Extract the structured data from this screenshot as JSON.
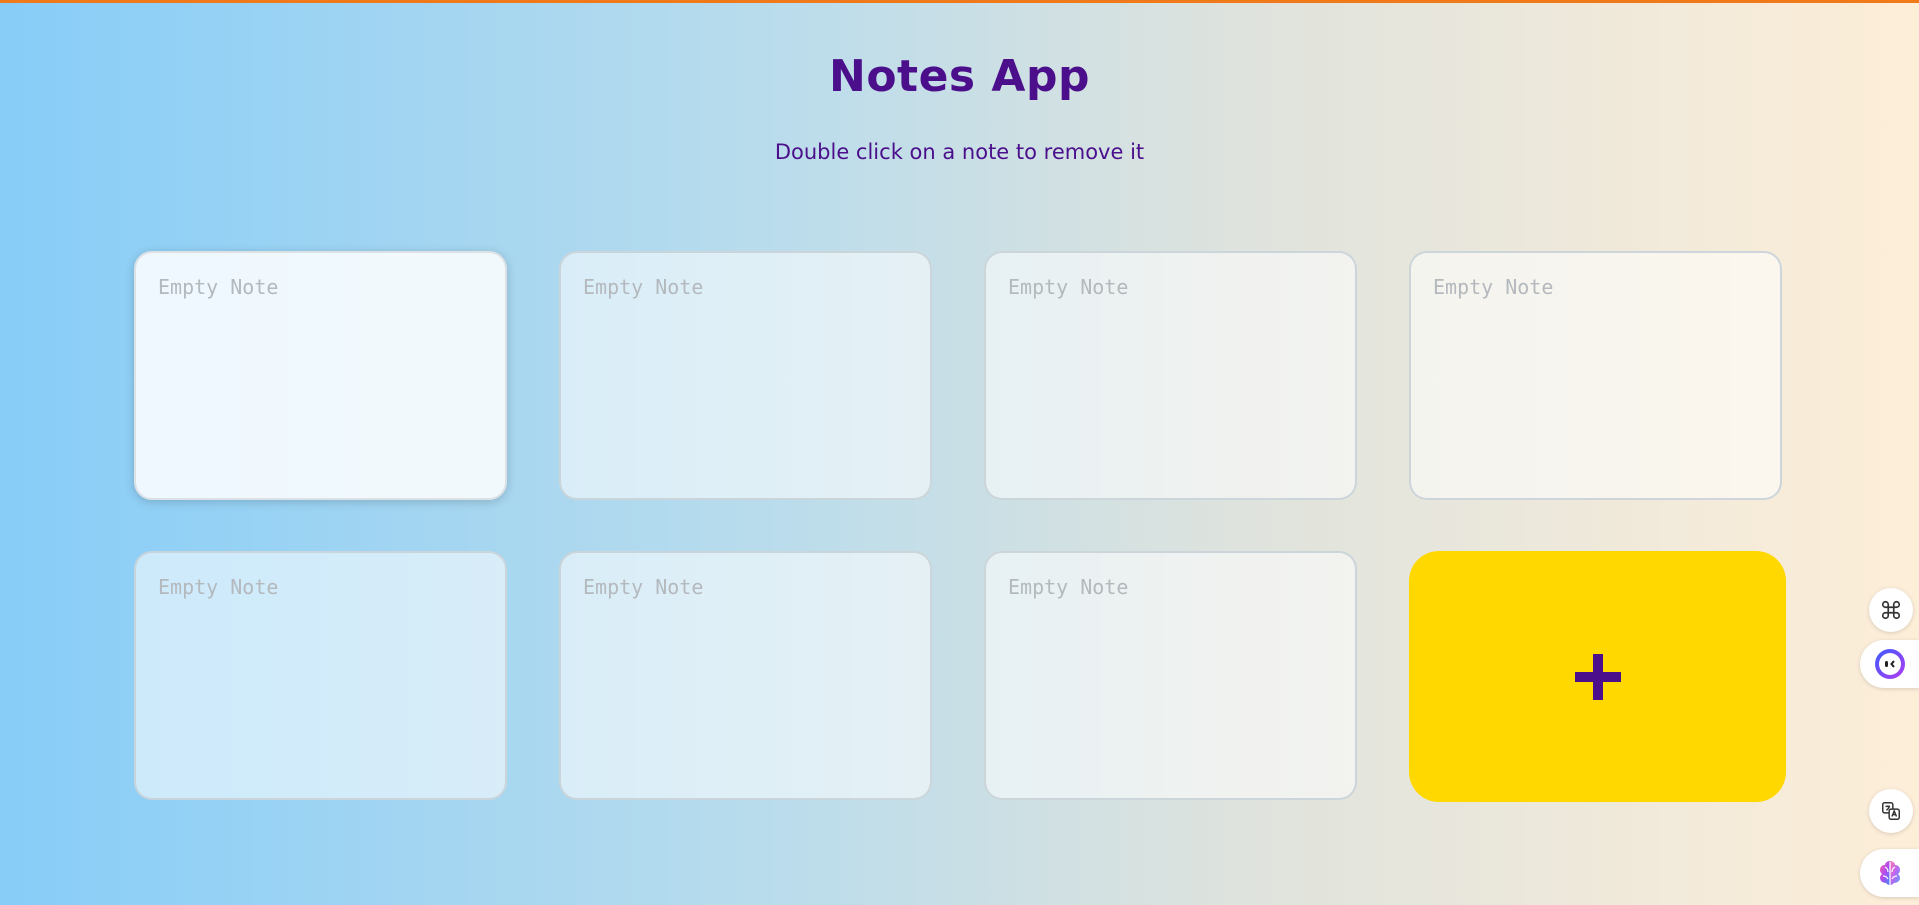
{
  "app": {
    "title": "Notes App",
    "subtitle": "Double click on a note to remove it"
  },
  "notes": [
    {
      "placeholder": "Empty Note",
      "value": ""
    },
    {
      "placeholder": "Empty Note",
      "value": ""
    },
    {
      "placeholder": "Empty Note",
      "value": ""
    },
    {
      "placeholder": "Empty Note",
      "value": ""
    },
    {
      "placeholder": "Empty Note",
      "value": ""
    },
    {
      "placeholder": "Empty Note",
      "value": ""
    },
    {
      "placeholder": "Empty Note",
      "value": ""
    }
  ],
  "add_button": {
    "icon": "plus-icon",
    "color": "#ffd800",
    "icon_color": "#4b0f8c"
  },
  "colors": {
    "accent_bar": "#f07a1a",
    "title_text": "#4b0f8c",
    "add_button_bg": "#ffd800"
  },
  "side_toolbar": {
    "icons": [
      "command-icon",
      "assistant-chat-icon",
      "translate-icon",
      "brain-icon"
    ]
  }
}
